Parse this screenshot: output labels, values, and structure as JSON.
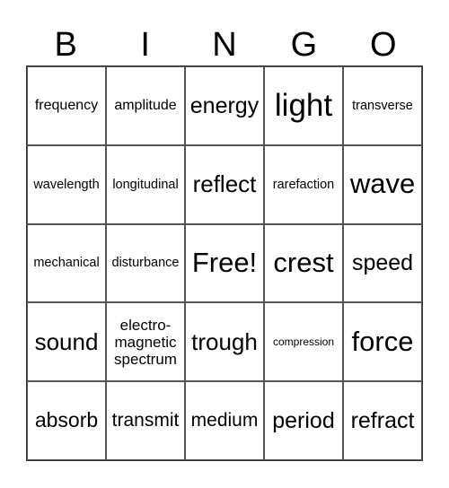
{
  "header": [
    "B",
    "I",
    "N",
    "G",
    "O"
  ],
  "board": [
    [
      "frequency",
      "amplitude",
      "energy",
      "light",
      "transverse"
    ],
    [
      "wavelength",
      "longitudinal",
      "reflect",
      "rarefaction",
      "wave"
    ],
    [
      "mechanical",
      "disturbance",
      "Free!",
      "crest",
      "speed"
    ],
    [
      "sound",
      "electro-\nmagnetic\nspectrum",
      "trough",
      "compression",
      "force"
    ],
    [
      "absorb",
      "transmit",
      "medium",
      "period",
      "refract"
    ]
  ]
}
